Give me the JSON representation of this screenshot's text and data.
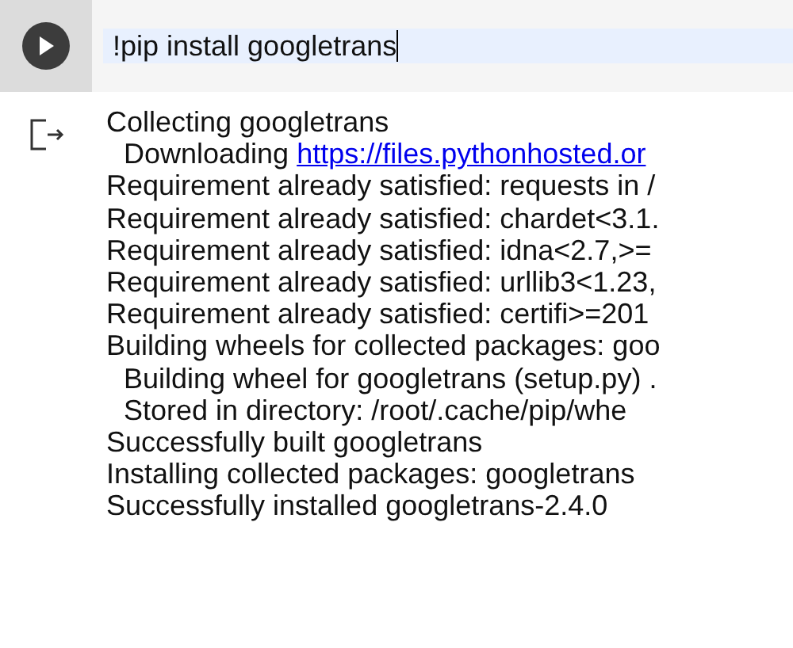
{
  "cell": {
    "code": "!pip install googletrans"
  },
  "output": [
    {
      "kind": "line",
      "indent": false,
      "text": "Collecting googletrans"
    },
    {
      "kind": "link",
      "text": "Downloading ",
      "link": "https://files.pythonhosted.or"
    },
    {
      "kind": "line",
      "indent": false,
      "text": "Requirement already satisfied: requests in /"
    },
    {
      "kind": "line",
      "indent": false,
      "text": "Requirement already satisfied: chardet<3.1."
    },
    {
      "kind": "line",
      "indent": false,
      "text": "Requirement already satisfied: idna<2.7,>="
    },
    {
      "kind": "line",
      "indent": false,
      "text": "Requirement already satisfied: urllib3<1.23,"
    },
    {
      "kind": "line",
      "indent": false,
      "text": "Requirement already satisfied: certifi>=201"
    },
    {
      "kind": "line",
      "indent": false,
      "text": "Building wheels for collected packages: goo"
    },
    {
      "kind": "line",
      "indent": true,
      "text": "Building wheel for googletrans (setup.py) ."
    },
    {
      "kind": "line",
      "indent": true,
      "text": "Stored in directory: /root/.cache/pip/whe"
    },
    {
      "kind": "line",
      "indent": false,
      "text": "Successfully built googletrans"
    },
    {
      "kind": "line",
      "indent": false,
      "text": "Installing collected packages: googletrans"
    },
    {
      "kind": "line",
      "indent": false,
      "text": "Successfully installed googletrans-2.4.0"
    }
  ]
}
